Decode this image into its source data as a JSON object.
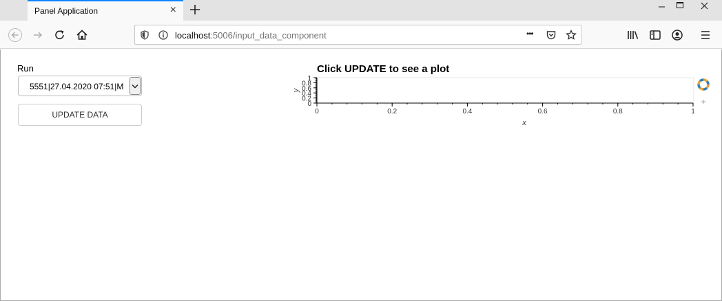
{
  "browser": {
    "tab_title": "Panel Application",
    "tab_close": "×",
    "url_host": "localhost",
    "url_rest": ":5006/input_data_component",
    "page_actions": "•••"
  },
  "form": {
    "run_label": "Run",
    "run_selected": "5551|27.04.2020 07:51|M",
    "update_label": "UPDATE DATA"
  },
  "chart_data": {
    "type": "line",
    "title": "Click UPDATE to see a plot",
    "xlabel": "x",
    "ylabel": "y",
    "xlim": [
      0,
      1
    ],
    "ylim": [
      0,
      1
    ],
    "xticks": [
      "0",
      "0.2",
      "0.4",
      "0.6",
      "0.8",
      "1"
    ],
    "yticks": [
      "0",
      "0.2",
      "0.4",
      "0.6",
      "0.8",
      "1"
    ],
    "series": []
  }
}
